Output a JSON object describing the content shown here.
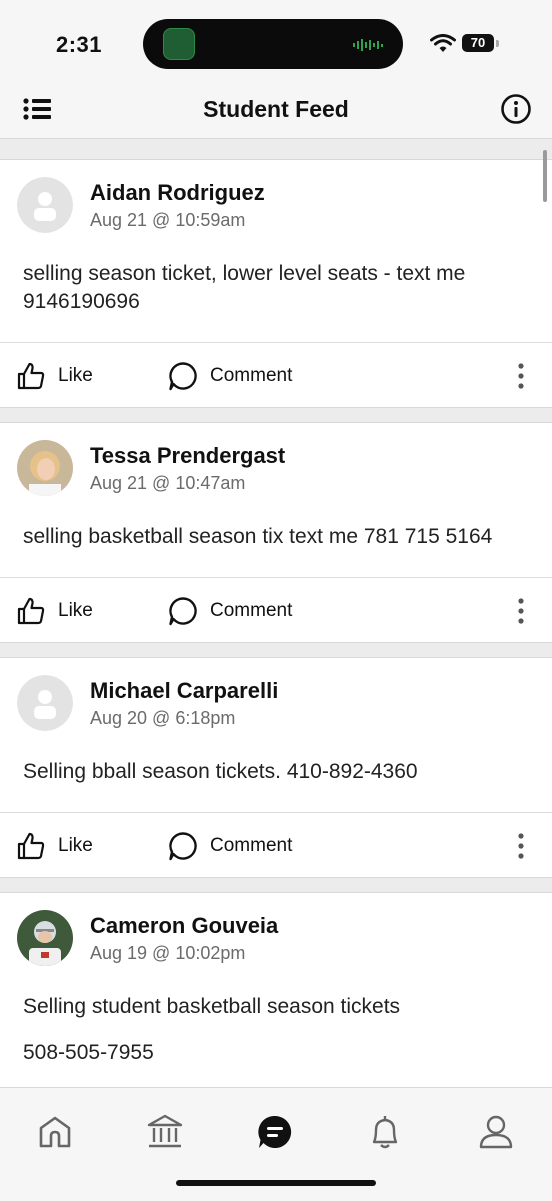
{
  "status_bar": {
    "time": "2:31",
    "battery": "70"
  },
  "header": {
    "title": "Student Feed",
    "menu_icon": "hamburger-menu-icon",
    "info_icon": "info-circle-icon"
  },
  "actions": {
    "like_label": "Like",
    "comment_label": "Comment"
  },
  "posts": [
    {
      "author": "Aidan Rodriguez",
      "timestamp": "Aug 21 @ 10:59am",
      "avatar": "placeholder",
      "body": [
        "selling season ticket, lower level seats - text me 9146190696"
      ]
    },
    {
      "author": "Tessa Prendergast",
      "timestamp": "Aug 21 @ 10:47am",
      "avatar": "photo",
      "body": [
        "selling basketball season tix text me 781 715 5164"
      ]
    },
    {
      "author": "Michael Carparelli",
      "timestamp": "Aug 20 @ 6:18pm",
      "avatar": "placeholder",
      "body": [
        "Selling bball season tickets. 410-892-4360"
      ]
    },
    {
      "author": "Cameron Gouveia",
      "timestamp": "Aug 19 @ 10:02pm",
      "avatar": "photo",
      "body": [
        "Selling student basketball season tickets",
        "508-505-7955"
      ]
    }
  ],
  "tabbar": {
    "tabs": [
      {
        "icon": "home-icon",
        "active": false
      },
      {
        "icon": "institution-icon",
        "active": false
      },
      {
        "icon": "feed-chat-icon",
        "active": true
      },
      {
        "icon": "bell-icon",
        "active": false
      },
      {
        "icon": "profile-icon",
        "active": false
      }
    ]
  },
  "colors": {
    "accent": "#111111",
    "muted_text": "#6b6b6b",
    "background": "#ececec",
    "card": "#ffffff"
  }
}
